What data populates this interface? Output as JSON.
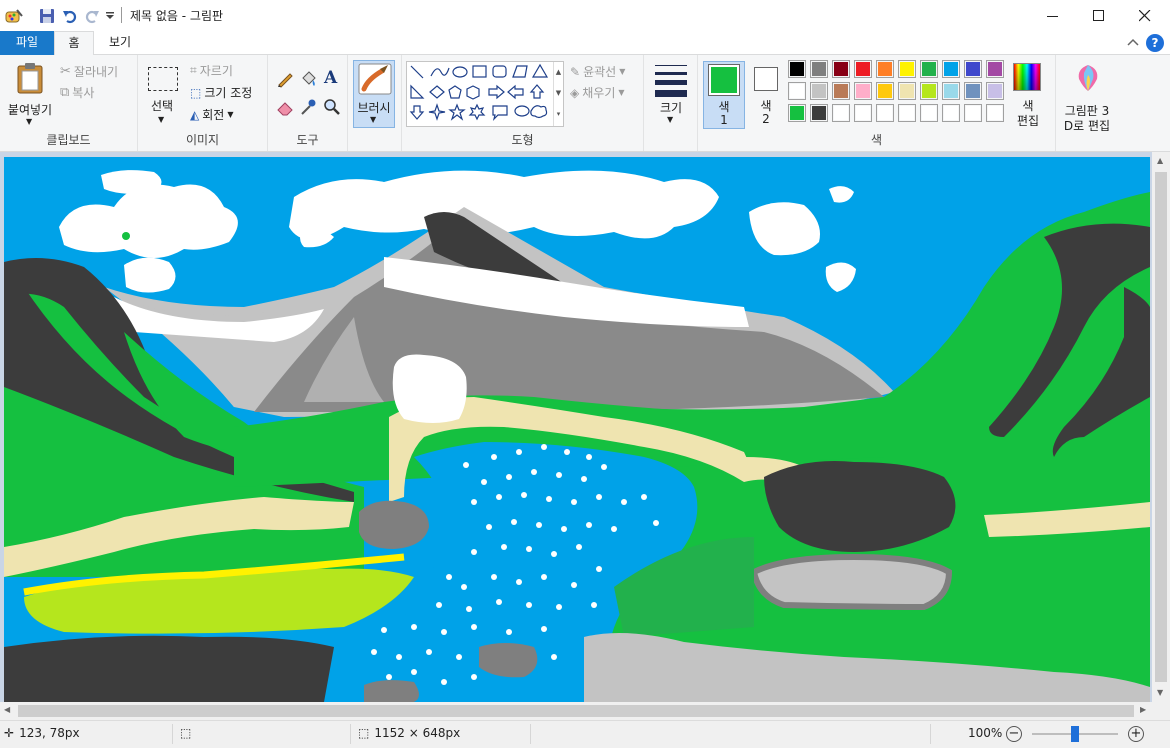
{
  "window": {
    "title": "제목 없음 - 그림판",
    "minimize_label": "—",
    "maximize_label": "☐",
    "close_label": "✕"
  },
  "quick_access": {
    "save_icon": "save-icon",
    "undo_icon": "undo-icon",
    "redo_icon": "redo-icon",
    "customize_icon": "customize-arrow-icon"
  },
  "tabs": [
    {
      "label": "파일"
    },
    {
      "label": "홈"
    },
    {
      "label": "보기"
    }
  ],
  "ribbon": {
    "clipboard": {
      "paste_label": "붙여넣기",
      "cut_label": "잘라내기",
      "copy_label": "복사",
      "group_label": "클립보드"
    },
    "image": {
      "select_label": "선택",
      "crop_label": "자르기",
      "resize_label": "크기 조정",
      "rotate_label": "회전",
      "group_label": "이미지"
    },
    "tools": {
      "group_label": "도구"
    },
    "brushes": {
      "label": "브러시"
    },
    "shapes": {
      "outline_label": "윤곽선",
      "fill_label": "채우기",
      "group_label": "도형"
    },
    "size": {
      "label": "크기"
    },
    "colors": {
      "color1_label": "색",
      "color1_num": "1",
      "color2_label": "색",
      "color2_num": "2",
      "color1_value": "#15c040",
      "color2_value": "#ffffff",
      "edit_colors_label1": "색",
      "edit_colors_label2": "편집",
      "group_label": "색",
      "palette": [
        "#000000",
        "#7f7f7f",
        "#880015",
        "#ed1c24",
        "#ff7f27",
        "#fff200",
        "#22b14c",
        "#00a2e8",
        "#3f48cc",
        "#a349a4",
        "#ffffff",
        "#c3c3c3",
        "#b97a57",
        "#ffaec9",
        "#ffc90e",
        "#efe4b0",
        "#b5e61d",
        "#99d9ea",
        "#7092be",
        "#c8bfe7",
        "#15c040",
        "#3c3c3c",
        "#ffffff",
        "#ffffff",
        "#ffffff",
        "#ffffff",
        "#ffffff",
        "#ffffff",
        "#ffffff",
        "#ffffff"
      ]
    },
    "paint3d": {
      "label1": "그림판 3",
      "label2": "D로 편집"
    }
  },
  "status": {
    "cursor_pos": "123, 78px",
    "image_size": "1152 × 648px",
    "zoom": "100%",
    "zoom_slider": 0.5
  }
}
